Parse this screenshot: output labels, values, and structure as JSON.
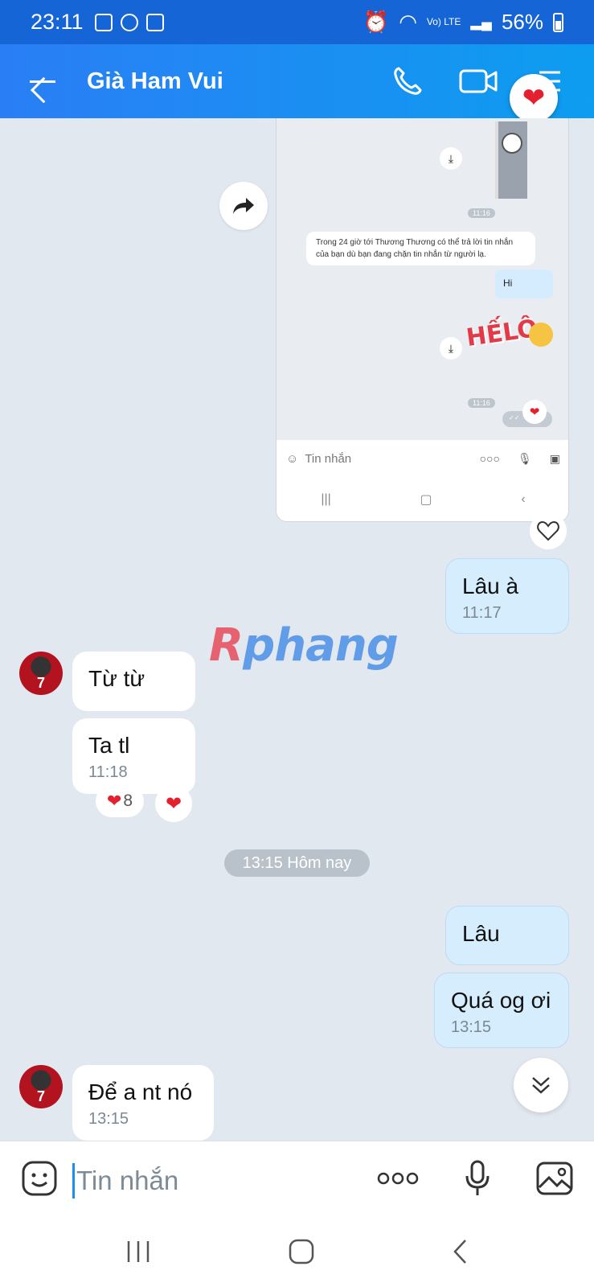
{
  "status_bar": {
    "time": "23:11",
    "network": "Vo) LTE",
    "battery": "56%"
  },
  "header": {
    "title": "Già Ham Vui"
  },
  "embedded": {
    "time1": "11:16",
    "notice": "Trong 24 giờ tới Thương Thương có thể trả lời tin nhắn của bạn dù bạn đang chặn tin nhắn từ người lạ.",
    "hi": "Hi",
    "hello_sticker": "HẾLÔ",
    "time2": "11:16",
    "input_placeholder": "Tin nhắn"
  },
  "messages": [
    {
      "side": "out",
      "text": "Lâu à",
      "time": "11:17"
    },
    {
      "side": "in",
      "text": "Từ từ"
    },
    {
      "side": "in",
      "text": "Ta tl",
      "time": "11:18",
      "reaction_count": "8"
    },
    {
      "side": "out",
      "text": "Lâu"
    },
    {
      "side": "out",
      "text": "Quá og ơi",
      "time": "13:15"
    },
    {
      "side": "in",
      "text": "Để a nt nó",
      "time": "13:15"
    }
  ],
  "day_separator": "13:15 Hôm nay",
  "avatar_label": "7",
  "watermark": {
    "first": "R",
    "rest": "phang"
  },
  "input": {
    "placeholder": "Tin nhắn"
  },
  "colors": {
    "header": "#2a7ef5",
    "outgoing": "#d5edfd",
    "incoming": "#ffffff",
    "heart": "#e5202e"
  }
}
